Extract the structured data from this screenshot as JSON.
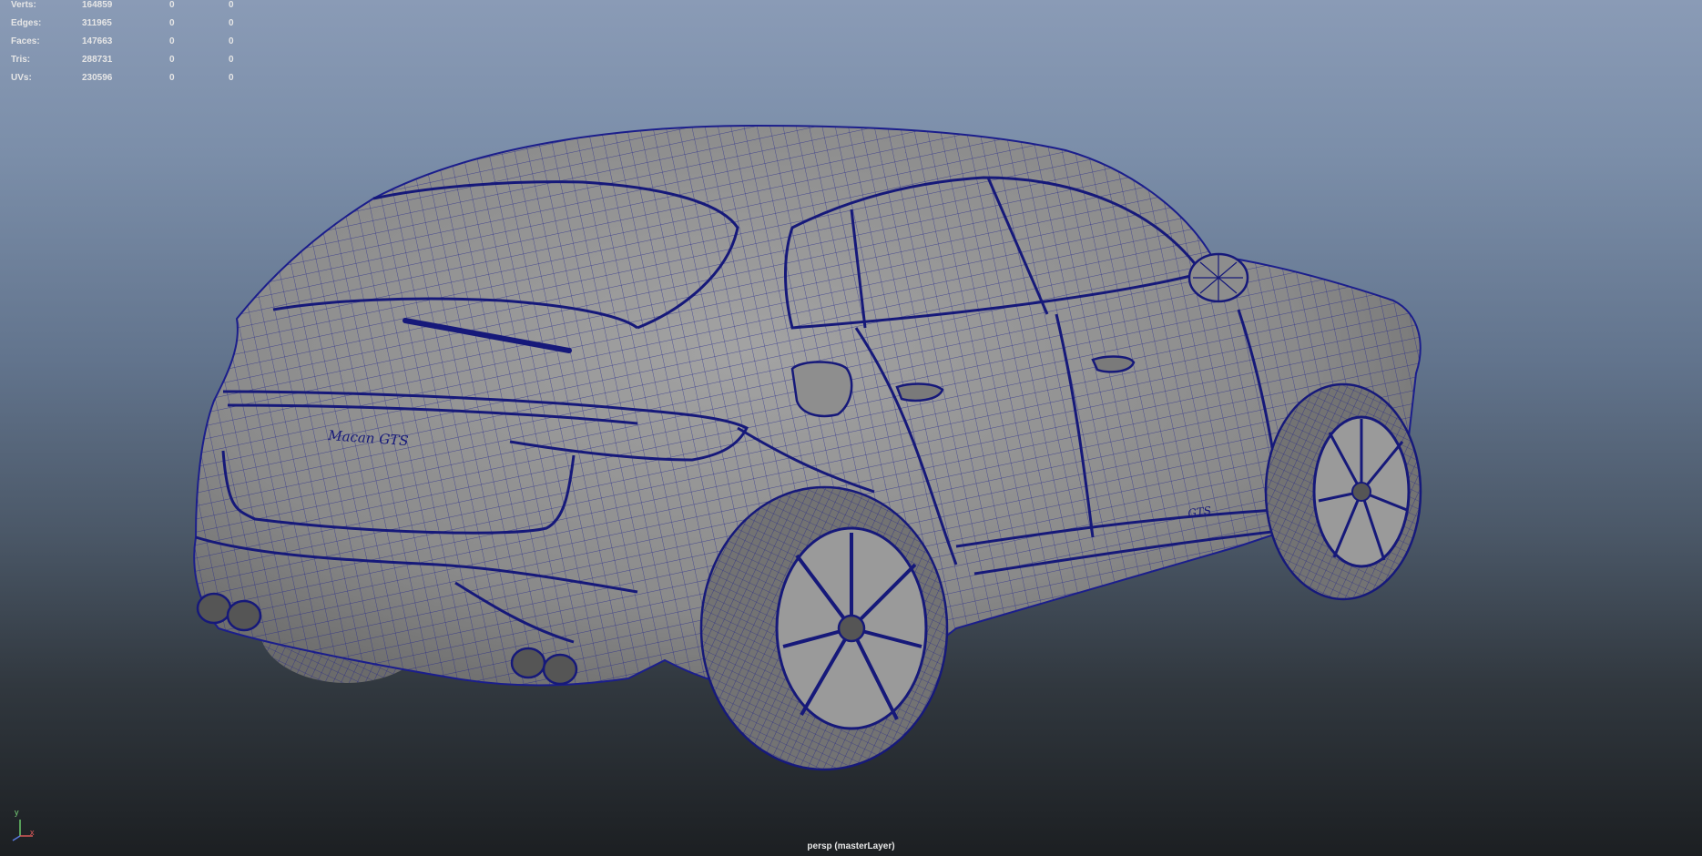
{
  "hud": {
    "rows": [
      {
        "label": "Verts:",
        "v1": "164859",
        "v2": "0",
        "v3": "0"
      },
      {
        "label": "Edges:",
        "v1": "311965",
        "v2": "0",
        "v3": "0"
      },
      {
        "label": "Faces:",
        "v1": "147663",
        "v2": "0",
        "v3": "0"
      },
      {
        "label": "Tris:",
        "v1": "288731",
        "v2": "0",
        "v3": "0"
      },
      {
        "label": "UVs:",
        "v1": "230596",
        "v2": "0",
        "v3": "0"
      }
    ]
  },
  "model": {
    "badge_rear": "Macan GTS",
    "badge_side": "GTS",
    "wireframe_color": "#1b1e8c",
    "shade_color": "#8a8a8a"
  },
  "axis": {
    "y_label": "y",
    "x_label": "x"
  },
  "viewport": {
    "camera_label": "persp (masterLayer)"
  }
}
